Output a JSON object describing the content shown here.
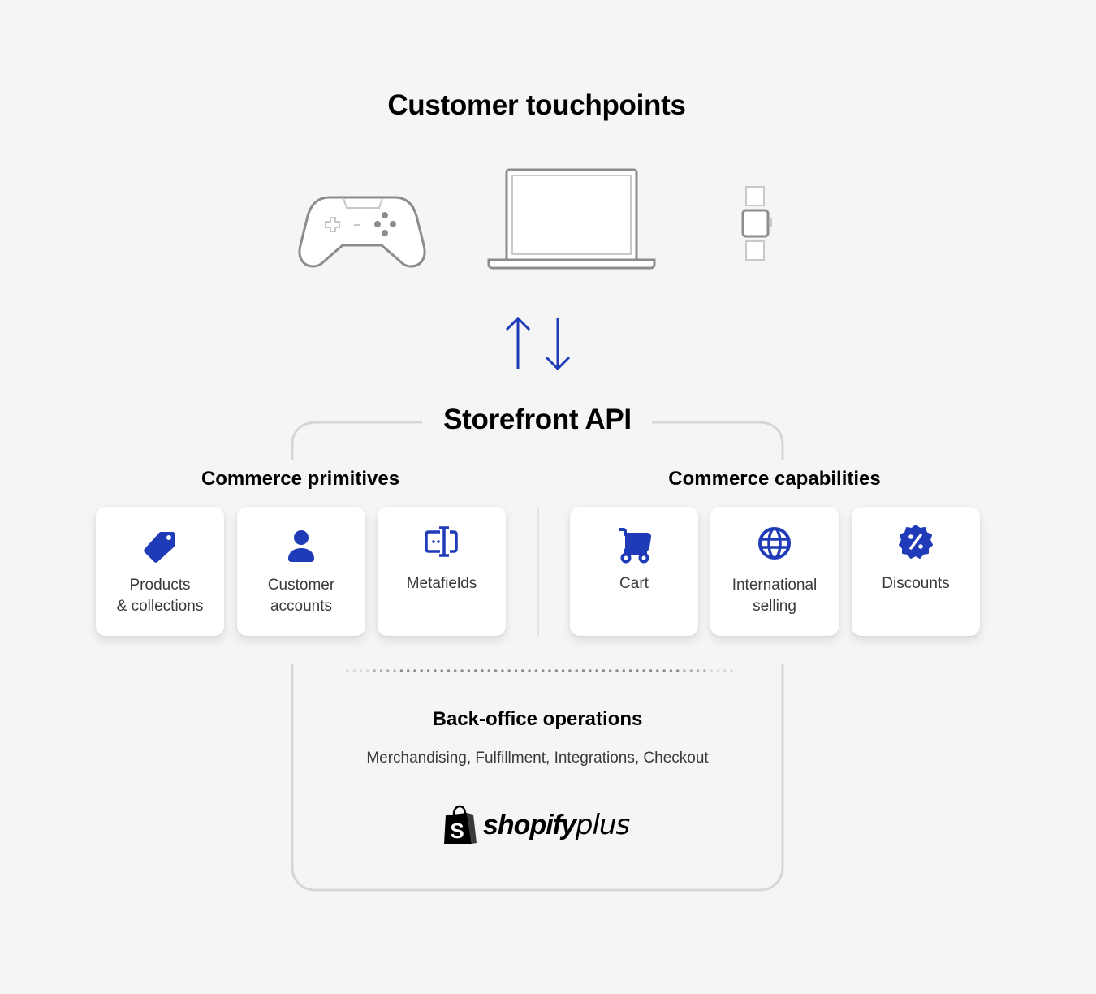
{
  "header": {
    "title": "Customer touchpoints"
  },
  "touchpoints": [
    {
      "name": "game-controller",
      "icon": "game-controller-icon"
    },
    {
      "name": "laptop",
      "icon": "laptop-icon"
    },
    {
      "name": "smartwatch",
      "icon": "smartwatch-icon"
    }
  ],
  "connector": {
    "up_icon": "arrow-up-icon",
    "down_icon": "arrow-down-icon",
    "color": "#1f3bb8"
  },
  "api": {
    "title": "Storefront API"
  },
  "primitives": {
    "title": "Commerce primitives",
    "items": [
      {
        "label": "Products\n& collections",
        "icon": "tag-icon"
      },
      {
        "label": "Customer\naccounts",
        "icon": "person-icon"
      },
      {
        "label": "Metafields",
        "icon": "metafields-icon"
      }
    ]
  },
  "capabilities": {
    "title": "Commerce capabilities",
    "items": [
      {
        "label": "Cart",
        "icon": "cart-icon"
      },
      {
        "label": "International\nselling",
        "icon": "globe-icon"
      },
      {
        "label": "Discounts",
        "icon": "discount-badge-icon"
      }
    ]
  },
  "backoffice": {
    "title": "Back-office operations",
    "subtitle": "Merchandising, Fulfillment, Integrations, Checkout"
  },
  "brand": {
    "word": "shopify",
    "suffix": "plus",
    "bag_letter": "S"
  },
  "colors": {
    "accent": "#1f3bb8",
    "device_stroke": "#8c8c8c",
    "device_light": "#c8c8c8",
    "frame": "#d6d6d6",
    "background": "#f5f5f5"
  }
}
